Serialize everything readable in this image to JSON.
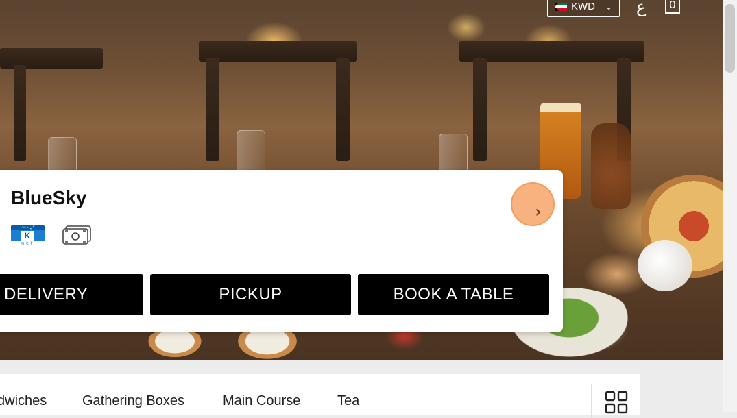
{
  "header": {
    "currency_label": "KWD",
    "language_label": "ع",
    "cart_count": "0"
  },
  "restaurant": {
    "name": "BlueSky",
    "payment_icons": [
      "knet-icon",
      "cash-icon"
    ]
  },
  "order_buttons": {
    "delivery": "DELIVERY",
    "pickup": "PICKUP",
    "book_table": "BOOK A TABLE"
  },
  "categories": [
    "dwiches",
    "Gathering Boxes",
    "Main Course",
    "Tea"
  ],
  "colors": {
    "button_bg": "#000000",
    "accent": "#f7b27f",
    "card_bg": "#ffffff"
  }
}
